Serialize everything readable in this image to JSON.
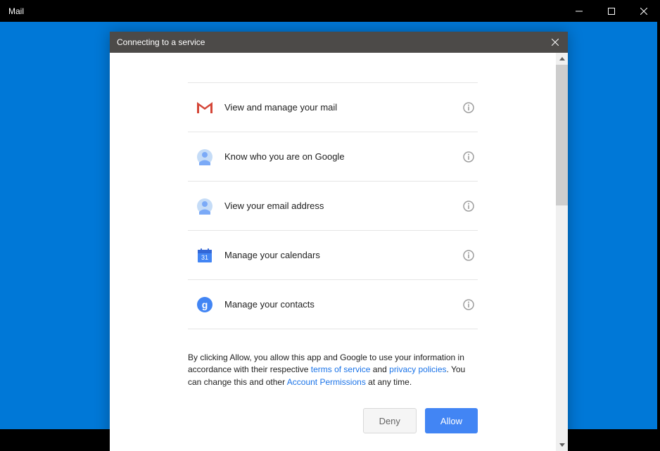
{
  "window": {
    "title": "Mail"
  },
  "dialog": {
    "title": "Connecting to a service"
  },
  "permissions": [
    {
      "label": "View and manage your mail"
    },
    {
      "label": "Know who you are on Google"
    },
    {
      "label": "View your email address"
    },
    {
      "label": "Manage your calendars"
    },
    {
      "label": "Manage your contacts"
    }
  ],
  "disclosure": {
    "prefix": "By clicking Allow, you allow this app and Google to use your information in accordance with their respective ",
    "tos": "terms of service",
    "and": " and ",
    "privacy": "privacy policies",
    "mid": ". You can change this and other ",
    "account_perms": "Account Permissions",
    "suffix": " at any time."
  },
  "buttons": {
    "deny": "Deny",
    "allow": "Allow"
  }
}
